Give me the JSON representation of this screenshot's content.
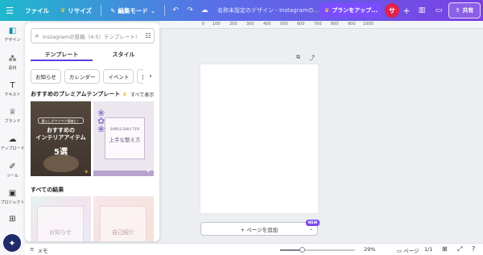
{
  "topbar": {
    "file_label": "ファイル",
    "resize_label": "リサイズ",
    "edit_mode_label": "編集モード",
    "title": "名称未設定のデザイン - Instagramの...",
    "plan_label": "プランをアップ...",
    "avatar_initial": "サ",
    "share_label": "共有"
  },
  "rail": {
    "items": [
      "デザイン",
      "素材",
      "テキスト",
      "ブランド",
      "アップロード",
      "ツール",
      "プロジェクト"
    ]
  },
  "panel": {
    "search_placeholder": "Instagramの投稿（4:5）テンプレート!",
    "tabs": [
      "テンプレート",
      "スタイル"
    ],
    "chips": [
      "お知らせ",
      "カレンダー",
      "イベント",
      "夏"
    ],
    "premium_title": "おすすめのプレミアムテンプレート",
    "see_all": "すべて表示",
    "all_results_title": "すべての結果",
    "card1": {
      "small": "暮らしがワクワク素敵に！",
      "line1": "おすすめの",
      "line2": "インテリアアイテム",
      "num": "5選"
    },
    "card2": {
      "sub": "SIMPLE DAILY TIPS",
      "main": "上手な整え方"
    },
    "card3": {
      "text": "お知らせ"
    },
    "card4": {
      "text": "自己紹介"
    }
  },
  "ruler": {
    "ticks": [
      "0",
      "100",
      "200",
      "300",
      "400",
      "500",
      "600",
      "700",
      "800",
      "900",
      "1000"
    ]
  },
  "canvas": {
    "add_page_label": "+ ページを追加",
    "new_badge": "NEW"
  },
  "bottombar": {
    "notes_label": "メモ",
    "zoom": "29%",
    "zoom_fraction": 0.29,
    "pages_label": "ページ",
    "page_count": "1/1"
  },
  "colors": {
    "topbar_start": "#1fb8cc",
    "topbar_end": "#7b3fe4",
    "accent": "#5a3fe4",
    "avatar": "#e0224a"
  }
}
